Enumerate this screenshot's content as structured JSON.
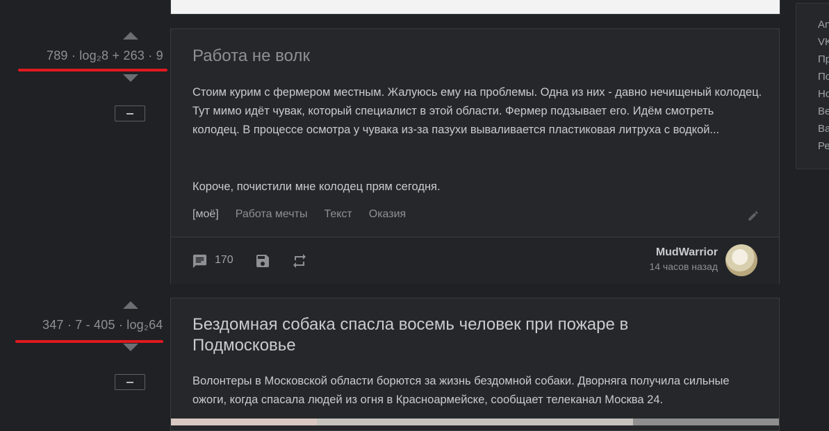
{
  "sidebar": {
    "items": [
      "An",
      "VK",
      "Пр",
      "По",
      "Но",
      "Ве",
      "Ва",
      "Ре"
    ]
  },
  "posts": [
    {
      "score": "789 · log₂8 + 263 · 9",
      "title": "Работа не волк",
      "paragraphs": [
        "Стоим курим с фермером местным. Жалуюсь ему на проблемы. Одна из них - давно нечищеный колодец. Тут мимо идёт чувак, который специалист в этой области. Фермер подзывает его. Идём смотреть колодец. В процессе осмотра у чувака из-за пазухи вываливается пластиковая литруха с водкой...",
        "Короче, почистили мне колодец прям сегодня."
      ],
      "tags": [
        "[моё]",
        "Работа мечты",
        "Текст",
        "Оказия"
      ],
      "comments": "170",
      "author": "MudWarrior",
      "time": "14 часов назад"
    },
    {
      "score": "347 · 7 - 405 · log₂64",
      "title": "Бездомная собака спасла восемь человек при пожаре в Подмосковье",
      "paragraphs": [
        "Волонтеры в Московской области борются за жизнь бездомной собаки. Дворняга получила сильные ожоги, когда спасала людей из огня в Красноармейске, сообщает телеканал Москва 24."
      ]
    }
  ],
  "colors": {
    "background": "#1f2124",
    "card": "#25272a",
    "highlight_line": "#e0191f"
  },
  "icons": [
    "comment-icon",
    "save-icon",
    "repost-icon",
    "edit-icon"
  ]
}
